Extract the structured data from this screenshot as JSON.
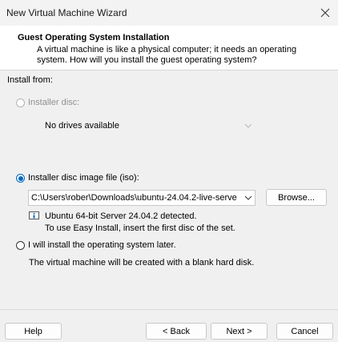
{
  "window": {
    "title": "New Virtual Machine Wizard"
  },
  "header": {
    "title": "Guest Operating System Installation",
    "description": "A virtual machine is like a physical computer; it needs an operating system. How will you install the guest operating system?"
  },
  "install_from_label": "Install from:",
  "installer_disc": {
    "label": "Installer disc:",
    "selected": false,
    "enabled": false,
    "dropdown_value": "No drives available"
  },
  "iso": {
    "label": "Installer disc image file (iso):",
    "selected": true,
    "path": "C:\\Users\\rober\\Downloads\\ubuntu-24.04.2-live-serve",
    "browse_label": "Browse...",
    "detected": "Ubuntu 64-bit Server 24.04.2 detected.",
    "note": "To use Easy Install, insert the first disc of the set."
  },
  "later": {
    "label": "I will install the operating system later.",
    "selected": false,
    "description": "The virtual machine will be created with a blank hard disk."
  },
  "footer": {
    "help": "Help",
    "back": "< Back",
    "next": "Next >",
    "cancel": "Cancel"
  },
  "colors": {
    "accent": "#0067c0",
    "header_bg": "#ffffff",
    "body_bg": "#f0f0f0"
  },
  "icons": {
    "close": "close-icon",
    "dropdown": "chevron-down-icon",
    "info": "info-icon"
  }
}
